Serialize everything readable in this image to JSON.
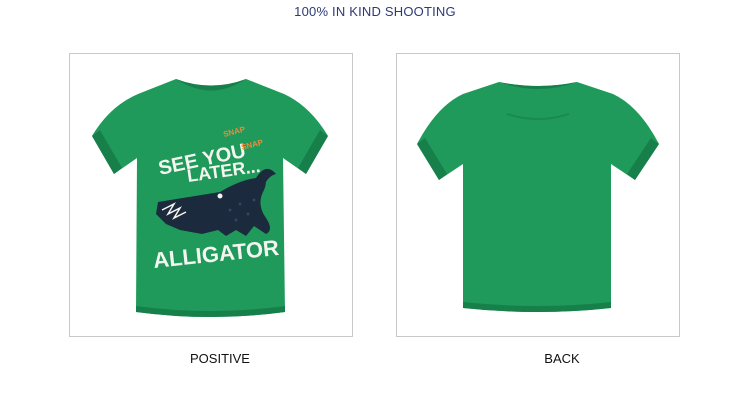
{
  "page": {
    "heading": "100% IN KIND SHOOTING"
  },
  "views": [
    {
      "caption": "POSITIVE",
      "print": {
        "line1": "SEE YOU",
        "line2": "LATER...",
        "line3": "ALLIGATOR",
        "snap1": "SNAP",
        "snap2": "SNAP"
      }
    },
    {
      "caption": "BACK"
    }
  ],
  "colors": {
    "shirt": "#1f9a5a",
    "shirt_shadow": "#17804a",
    "print_white": "#f4f4f0",
    "print_orange": "#f08a3a",
    "alligator": "#1b2a3c"
  }
}
